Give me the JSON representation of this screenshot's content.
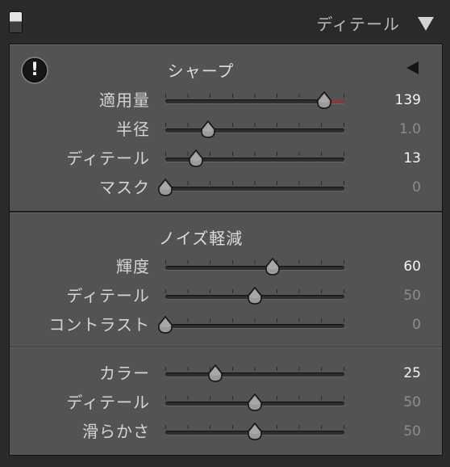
{
  "panel": {
    "title": "ディテール",
    "toggle_icon": "panel-toggle-switch",
    "collapse_icon": "triangle-down-icon"
  },
  "sharpening": {
    "heading": "シャープ",
    "warning_icon": "exclamation-circle-icon",
    "warning_symbol": "!",
    "arrow_icon": "triangle-left-icon",
    "sliders": [
      {
        "label": "適用量",
        "value": "139",
        "level": 0.887,
        "active": true,
        "track_tint": "#7a4040"
      },
      {
        "label": "半径",
        "value": "1.0",
        "level": 0.24,
        "active": false
      },
      {
        "label": "ディテール",
        "value": "13",
        "level": 0.17,
        "active": true
      },
      {
        "label": "マスク",
        "value": "0",
        "level": 0.0,
        "active": false
      }
    ]
  },
  "noise_reduction": {
    "heading": "ノイズ軽減",
    "luminance_sliders": [
      {
        "label": "輝度",
        "value": "60",
        "level": 0.6,
        "active": true
      },
      {
        "label": "ディテール",
        "value": "50",
        "level": 0.5,
        "active": false
      },
      {
        "label": "コントラスト",
        "value": "0",
        "level": 0.0,
        "active": false
      }
    ],
    "color_sliders": [
      {
        "label": "カラー",
        "value": "25",
        "level": 0.28,
        "active": true
      },
      {
        "label": "ディテール",
        "value": "50",
        "level": 0.5,
        "active": false
      },
      {
        "label": "滑らかさ",
        "value": "50",
        "level": 0.5,
        "active": false
      }
    ]
  },
  "colors": {
    "panel_bg": "#535353",
    "header_bg": "#2a2a2a",
    "active_value": "#f4f4f4",
    "inactive_value": "#8c8c8c",
    "amount_track_tint": "#7a4040"
  }
}
